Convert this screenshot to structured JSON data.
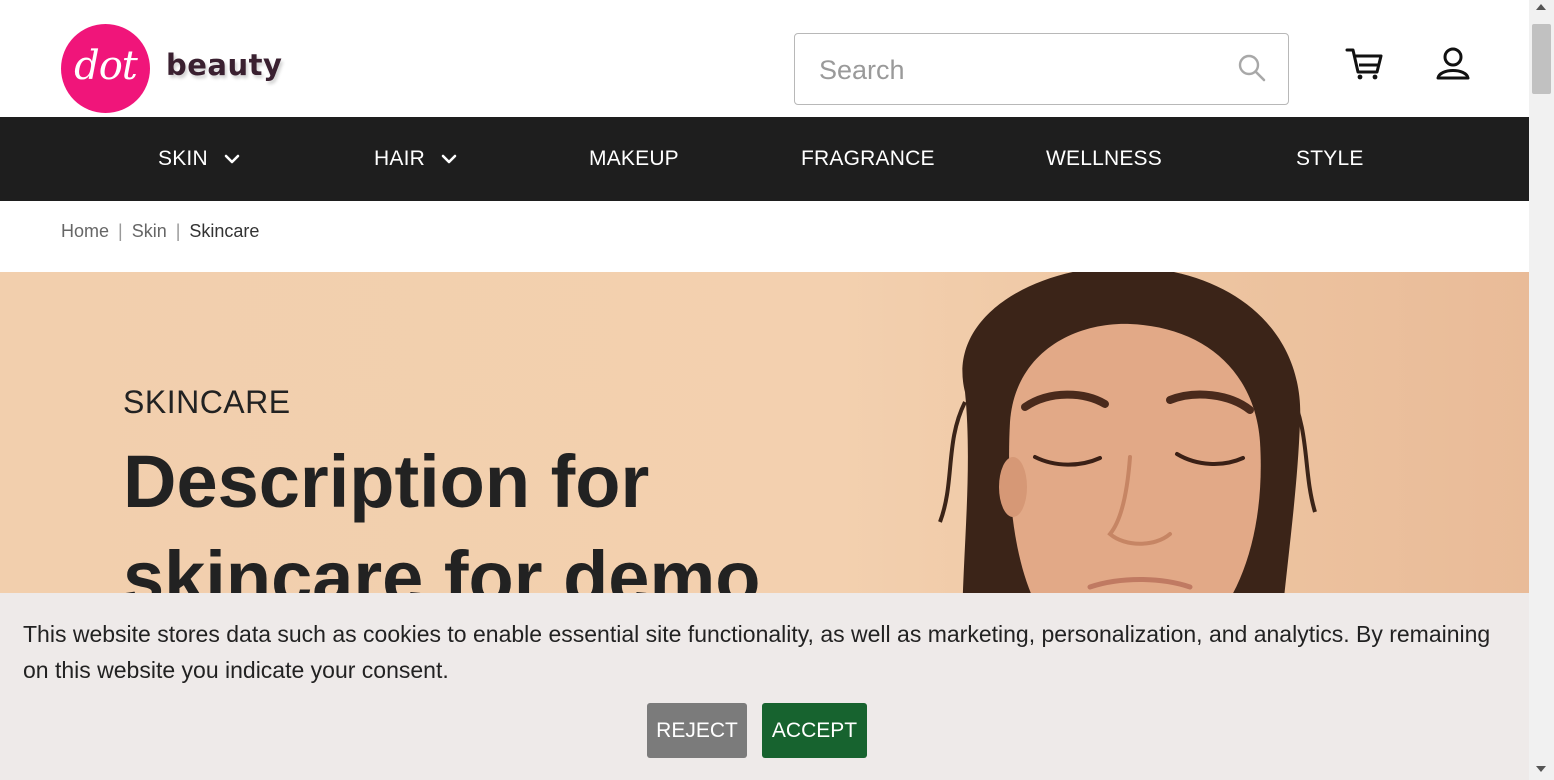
{
  "header": {
    "logo_mark": "dot",
    "logo_text": "beauty",
    "search_placeholder": "Search",
    "search_value": ""
  },
  "nav": {
    "items": [
      {
        "label": "SKIN",
        "has_dropdown": true
      },
      {
        "label": "HAIR",
        "has_dropdown": true
      },
      {
        "label": "MAKEUP",
        "has_dropdown": false
      },
      {
        "label": "FRAGRANCE",
        "has_dropdown": false
      },
      {
        "label": "WELLNESS",
        "has_dropdown": false
      },
      {
        "label": "STYLE",
        "has_dropdown": false
      }
    ]
  },
  "breadcrumb": {
    "items": [
      "Home",
      "Skin",
      "Skincare"
    ],
    "separator": "|"
  },
  "hero": {
    "eyebrow": "SKINCARE",
    "title": "Description for skincare for demo"
  },
  "cookie_banner": {
    "text": "This website stores data such as cookies to enable essential site functionality, as well as marketing, personalization, and analytics. By remaining on this website you indicate your consent.",
    "reject_label": "REJECT",
    "accept_label": "ACCEPT"
  },
  "colors": {
    "brand_pink": "#f0157a",
    "nav_bg": "#1e1e1e",
    "hero_bg": "#f2cfad",
    "accept_green": "#17632f",
    "reject_gray": "#7b7b7b",
    "cookie_bg": "#eeeae9"
  }
}
